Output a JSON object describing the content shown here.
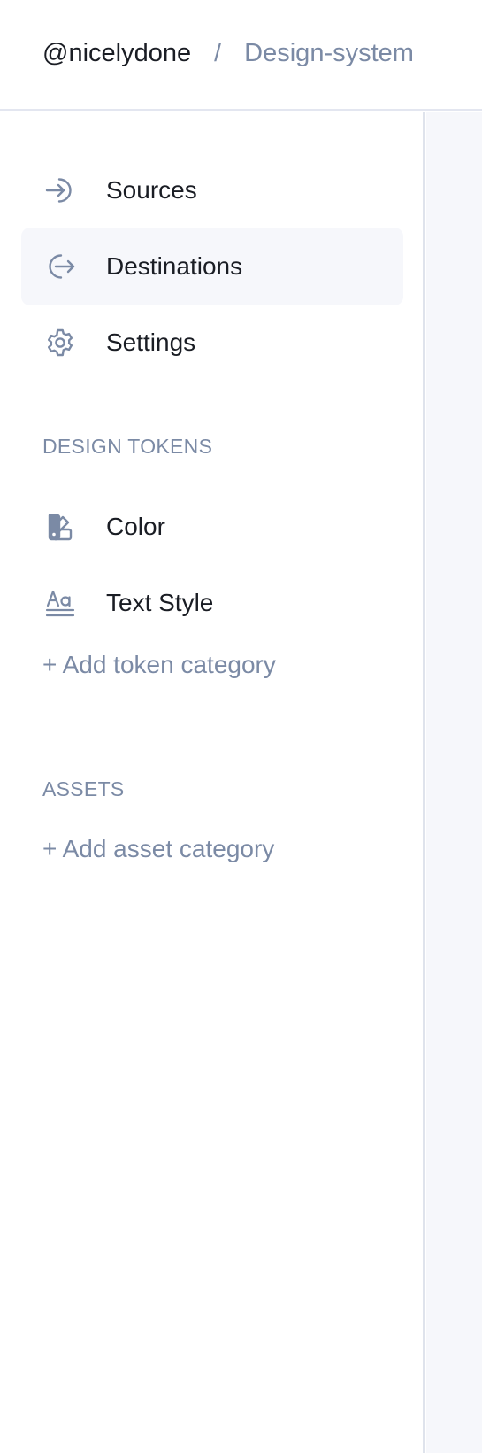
{
  "breadcrumb": {
    "org": "@nicelydone",
    "separator": "/",
    "project": "Design-system"
  },
  "colors": {
    "text_primary": "#1a1d24",
    "text_muted": "#7b8aa5",
    "active_bg": "#f6f7fb",
    "border": "#e3e6f0"
  },
  "nav": {
    "items": [
      {
        "label": "Sources",
        "icon": "sign-in-arrow-icon"
      },
      {
        "label": "Destinations",
        "icon": "sign-out-arrow-icon",
        "active": true
      },
      {
        "label": "Settings",
        "icon": "gear-icon"
      }
    ]
  },
  "design_tokens": {
    "title": "DESIGN TOKENS",
    "items": [
      {
        "label": "Color",
        "icon": "color-swatch-icon"
      },
      {
        "label": "Text Style",
        "icon": "text-style-icon"
      }
    ],
    "add_label": "+ Add token category"
  },
  "assets": {
    "title": "ASSETS",
    "add_label": "+ Add asset category"
  }
}
